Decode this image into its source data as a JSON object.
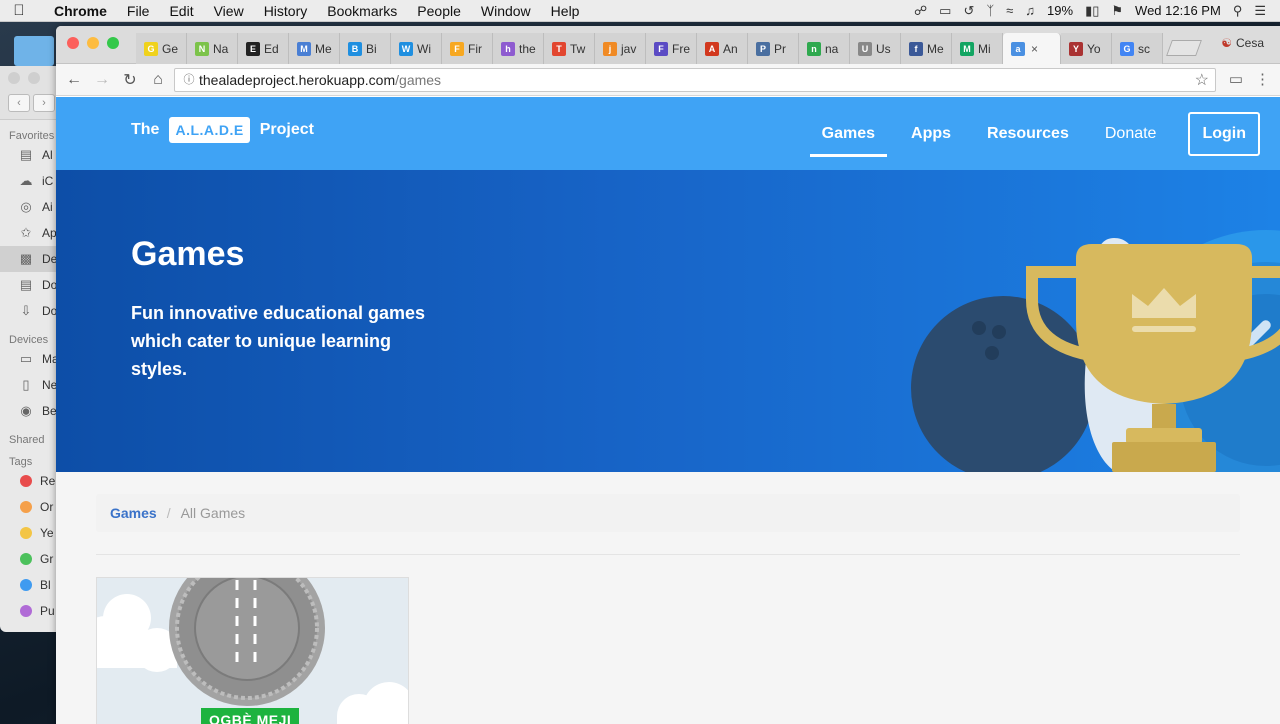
{
  "menubar": {
    "app": "Chrome",
    "items": [
      "File",
      "Edit",
      "View",
      "History",
      "Bookmarks",
      "People",
      "Window",
      "Help"
    ],
    "battery": "19%",
    "clock": "Wed 12:16 PM"
  },
  "finder": {
    "favorites_label": "Favorites",
    "favorites": [
      "Al",
      "iC",
      "Ai",
      "Ap",
      "De",
      "Do",
      "Do"
    ],
    "devices_label": "Devices",
    "devices": [
      "Ma",
      "Ne",
      "Be"
    ],
    "shared_label": "Shared",
    "tags_label": "Tags",
    "tags": [
      {
        "label": "Re",
        "color": "#e84c4c"
      },
      {
        "label": "Or",
        "color": "#f5a04a"
      },
      {
        "label": "Ye",
        "color": "#f3c545"
      },
      {
        "label": "Gr",
        "color": "#4cc15c"
      },
      {
        "label": "Bl",
        "color": "#3f9bf0"
      },
      {
        "label": "Pu",
        "color": "#b06bd6"
      }
    ]
  },
  "tabs": [
    {
      "label": "Ge",
      "icon": "G"
    },
    {
      "label": "Na",
      "icon": "N"
    },
    {
      "label": "Ed",
      "icon": "E"
    },
    {
      "label": "Me",
      "icon": "M"
    },
    {
      "label": "Bi",
      "icon": "B"
    },
    {
      "label": "Wi",
      "icon": "W"
    },
    {
      "label": "Fir",
      "icon": "F"
    },
    {
      "label": "the",
      "icon": "h"
    },
    {
      "label": "Tw",
      "icon": "T"
    },
    {
      "label": "jav",
      "icon": "j"
    },
    {
      "label": "Fre",
      "icon": "F"
    },
    {
      "label": "An",
      "icon": "A"
    },
    {
      "label": "Pr",
      "icon": "P"
    },
    {
      "label": "na",
      "icon": "n"
    },
    {
      "label": "Us",
      "icon": "U"
    },
    {
      "label": "Me",
      "icon": "f"
    },
    {
      "label": "Mi",
      "icon": "M"
    },
    {
      "label": "×",
      "icon": "a",
      "active": true
    },
    {
      "label": "Yo",
      "icon": "Y"
    },
    {
      "label": "sc",
      "icon": "G"
    }
  ],
  "profile_name": "Cesa",
  "address": {
    "host": "thealadeproject.herokuapp.com",
    "path": "/games"
  },
  "site": {
    "brand_left": "The",
    "brand_pill": "A.L.A.D.E",
    "brand_right": "Project",
    "nav": [
      {
        "label": "Games",
        "active": true
      },
      {
        "label": "Apps"
      },
      {
        "label": "Resources"
      },
      {
        "label": "Donate"
      }
    ],
    "login": "Login",
    "hero_title": "Games",
    "hero_sub": "Fun innovative educational games which cater to unique learning styles.",
    "breadcrumb_link": "Games",
    "breadcrumb_sep": "/",
    "breadcrumb_current": "All Games",
    "game_badge": "OGBÈ MEJI"
  },
  "colors": {
    "navbar": "#3fa3f5",
    "hero_dark": "#0d4ea7",
    "hero_light": "#1d82e6",
    "trophy": "#d7b95e",
    "link": "#3b73c9"
  }
}
